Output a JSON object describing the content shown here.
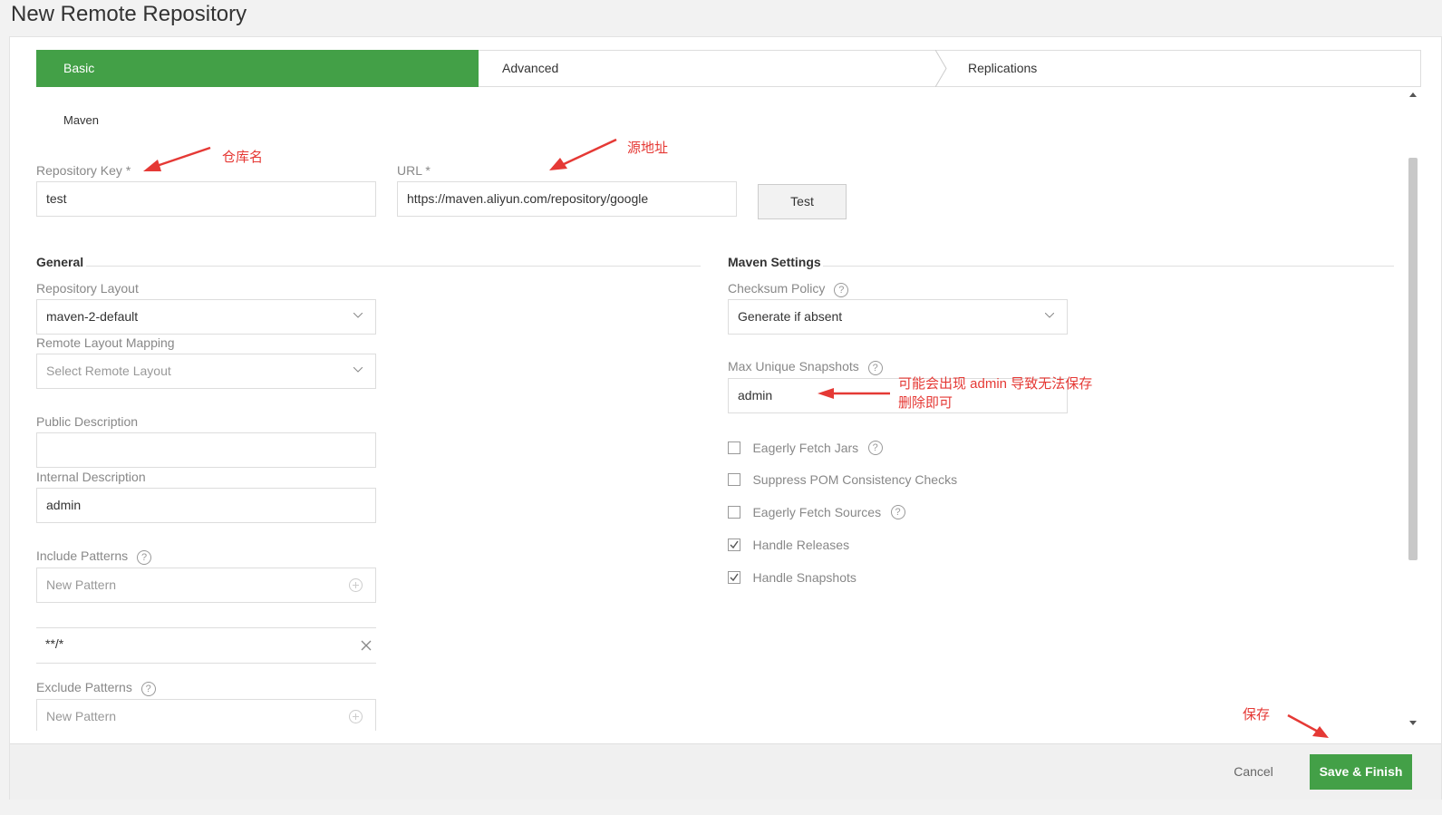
{
  "page": {
    "title": "New Remote Repository"
  },
  "wizard": {
    "steps": [
      "Basic",
      "Advanced",
      "Replications"
    ]
  },
  "package_type": "Maven",
  "repo_key": {
    "label": "Repository Key *",
    "value": "test"
  },
  "url": {
    "label": "URL *",
    "value": "https://maven.aliyun.com/repository/google"
  },
  "test_button": "Test",
  "general": {
    "title": "General",
    "layout_label": "Repository Layout",
    "layout_value": "maven-2-default",
    "remote_layout_label": "Remote Layout Mapping",
    "remote_layout_placeholder": "Select Remote Layout",
    "public_desc_label": "Public Description",
    "public_desc_value": "",
    "internal_desc_label": "Internal Description",
    "internal_desc_value": "admin",
    "include_label": "Include Patterns",
    "include_placeholder": "New Pattern",
    "include_item": "**/*",
    "exclude_label": "Exclude Patterns",
    "exclude_placeholder": "New Pattern"
  },
  "maven": {
    "title": "Maven Settings",
    "checksum_label": "Checksum Policy",
    "checksum_value": "Generate if absent",
    "max_snap_label": "Max Unique Snapshots",
    "max_snap_value": "admin",
    "checkboxes": [
      {
        "label": "Eagerly Fetch Jars",
        "checked": false
      },
      {
        "label": "Suppress POM Consistency Checks",
        "checked": false
      },
      {
        "label": "Eagerly Fetch Sources",
        "checked": false
      },
      {
        "label": "Handle Releases",
        "checked": true
      },
      {
        "label": "Handle Snapshots",
        "checked": true
      }
    ]
  },
  "annotations": {
    "repo_name": "仓库名",
    "source_url": "源地址",
    "admin_line1": "可能会出现 admin 导致无法保存",
    "admin_line2": "删除即可",
    "save": "保存"
  },
  "footer": {
    "cancel": "Cancel",
    "save_finish": "Save & Finish"
  },
  "colors": {
    "accent": "#43a047",
    "annotation": "#e53935"
  }
}
